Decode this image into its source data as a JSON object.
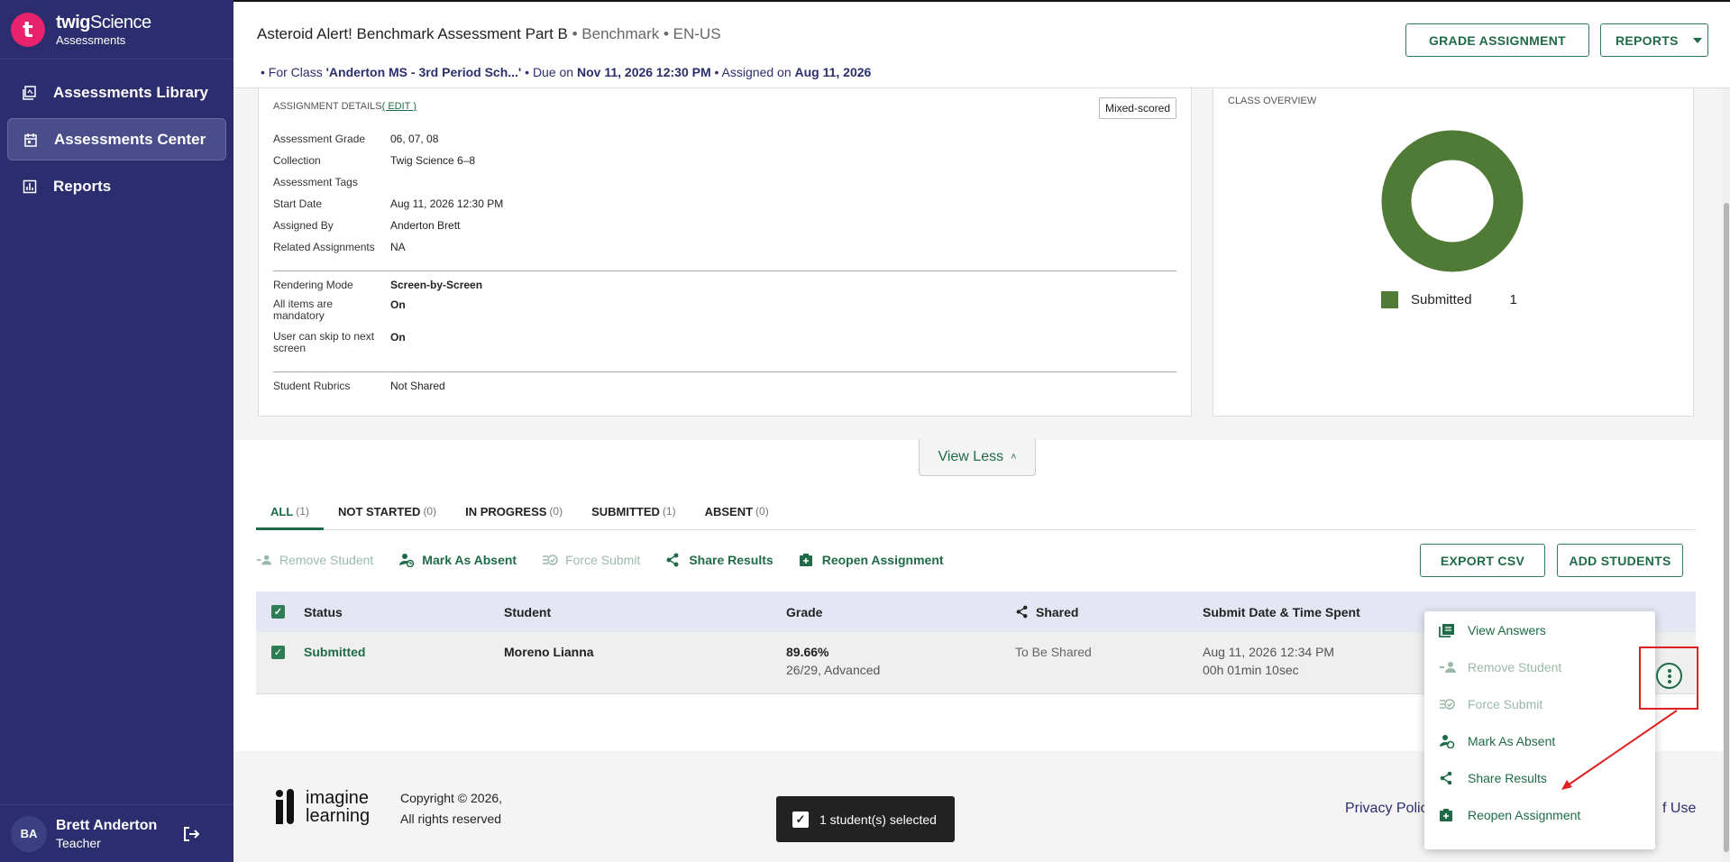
{
  "brand": {
    "logo_letter": "t",
    "name_bold": "twig",
    "name_light": "Science",
    "sub": "Assessments"
  },
  "nav": [
    {
      "label": "Assessments Library",
      "icon": "library-icon",
      "active": false
    },
    {
      "label": "Assessments Center",
      "icon": "calendar-icon",
      "active": true
    },
    {
      "label": "Reports",
      "icon": "chart-icon",
      "active": false
    }
  ],
  "user": {
    "initials": "BA",
    "name": "Brett Anderton",
    "role": "Teacher"
  },
  "header": {
    "title": "Asteroid Alert! Benchmark Assessment Part B",
    "meta": " • Benchmark • EN-US",
    "sub_prefix": "•  For Class ",
    "class_name": "'Anderton MS - 3rd Period Sch...'",
    "due_prefix": "  •  Due on ",
    "due": "Nov 11, 2026 12:30 PM",
    "assigned_prefix": "  •  Assigned on ",
    "assigned": "Aug 11, 2026",
    "grade_btn": "GRADE ASSIGNMENT",
    "reports_btn": "REPORTS"
  },
  "details": {
    "heading": "ASSIGNMENT DETAILS",
    "edit": "( EDIT )",
    "badge": "Mixed-scored",
    "rows": [
      {
        "label": "Assessment Grade",
        "value": "06, 07, 08"
      },
      {
        "label": "Collection",
        "value": "Twig Science 6–8"
      },
      {
        "label": "Assessment Tags",
        "value": ""
      },
      {
        "label": "Start Date",
        "value": "Aug 11, 2026 12:30 PM"
      },
      {
        "label": "Assigned By",
        "value": "Anderton Brett"
      },
      {
        "label": "Related Assignments",
        "value": "NA"
      }
    ],
    "rows2": [
      {
        "label": "Rendering Mode",
        "value": "Screen-by-Screen"
      },
      {
        "label": "All items are mandatory",
        "value": "On"
      },
      {
        "label": "User can skip to next screen",
        "value": "On"
      }
    ],
    "rows3": [
      {
        "label": "Student Rubrics",
        "value": "Not Shared"
      }
    ]
  },
  "overview": {
    "heading": "CLASS OVERVIEW",
    "legend_label": "Submitted",
    "legend_count": "1",
    "color": "#4f7b36"
  },
  "view_less": "View Less",
  "tabs": [
    {
      "label": "ALL",
      "count": "(1)",
      "active": true
    },
    {
      "label": "NOT STARTED",
      "count": "(0)",
      "active": false
    },
    {
      "label": "IN PROGRESS",
      "count": "(0)",
      "active": false
    },
    {
      "label": "SUBMITTED",
      "count": "(1)",
      "active": false
    },
    {
      "label": "ABSENT",
      "count": "(0)",
      "active": false
    }
  ],
  "actions": {
    "remove": "Remove Student",
    "absent": "Mark As Absent",
    "force": "Force Submit",
    "share": "Share Results",
    "reopen": "Reopen Assignment",
    "export": "EXPORT CSV",
    "add": "ADD STUDENTS"
  },
  "table": {
    "headers": {
      "status": "Status",
      "student": "Student",
      "grade": "Grade",
      "shared": "Shared",
      "submit": "Submit Date & Time Spent"
    },
    "rows": [
      {
        "status": "Submitted",
        "student": "Moreno Lianna",
        "grade": "89.66%",
        "grade_sub": "26/29, Advanced",
        "shared": "To Be Shared",
        "submit": "Aug 11, 2026 12:34 PM",
        "time": "00h 01min 10sec"
      }
    ]
  },
  "menu": {
    "view_answers": "View Answers",
    "remove": "Remove Student",
    "force": "Force Submit",
    "absent": "Mark As Absent",
    "share": "Share Results",
    "reopen": "Reopen Assignment"
  },
  "footer": {
    "logo_line1": "imagine",
    "logo_line2": "learning",
    "copyright1": "Copyright © 2026,",
    "copyright2": "All rights reserved",
    "privacy": "Privacy Polic",
    "terms": "f Use"
  },
  "toast": "1 student(s) selected"
}
